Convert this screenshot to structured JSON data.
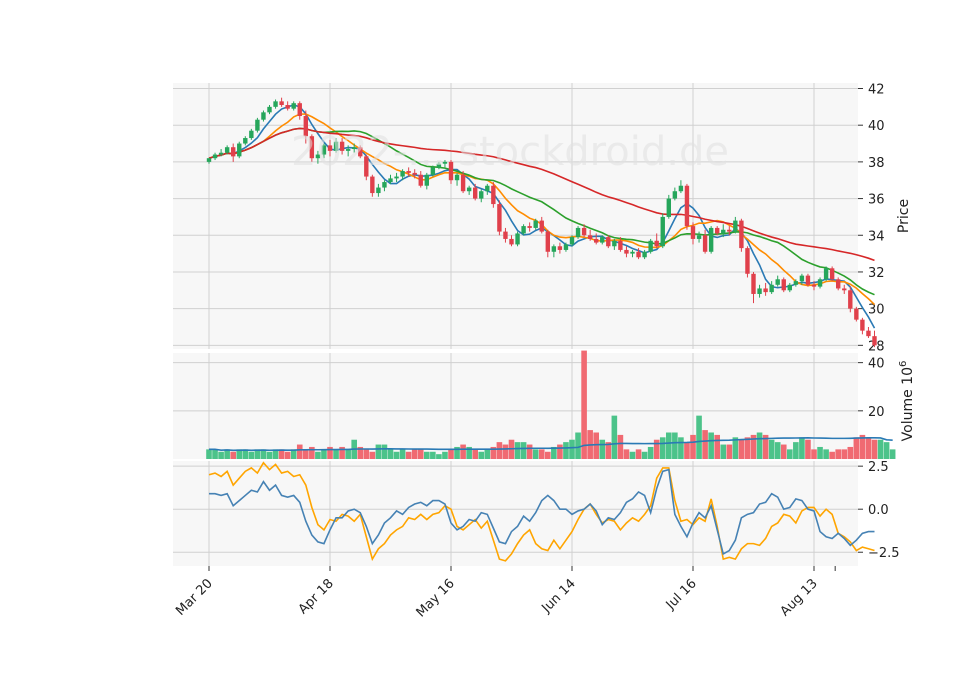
{
  "chart_data": {
    "type": "candlestick",
    "watermark": "2022-... stockdroid.de",
    "x_tick_labels": [
      "Mar 20",
      "Apr 18",
      "May 16",
      "Jun 14",
      "Jul 16",
      "Aug 13"
    ],
    "x_tick_positions": [
      0,
      20,
      40,
      60,
      80,
      100
    ],
    "panels": [
      {
        "name": "price",
        "ylabel": "Price",
        "ylim": [
          27.8,
          42.3
        ],
        "yticks": [
          28,
          30,
          32,
          34,
          36,
          38,
          40,
          42
        ],
        "up_color": "#26a65b",
        "down_color": "#e0404b",
        "ohlc": [
          [
            38.0,
            38.2,
            37.9,
            38.2
          ],
          [
            38.2,
            38.5,
            38.1,
            38.4
          ],
          [
            38.4,
            38.7,
            38.3,
            38.5
          ],
          [
            38.5,
            38.9,
            38.4,
            38.8
          ],
          [
            38.8,
            39.0,
            38.0,
            38.3
          ],
          [
            38.3,
            39.1,
            38.2,
            39.0
          ],
          [
            39.0,
            39.4,
            38.9,
            39.3
          ],
          [
            39.3,
            39.8,
            39.2,
            39.7
          ],
          [
            39.7,
            40.4,
            39.6,
            40.3
          ],
          [
            40.3,
            40.8,
            40.2,
            40.7
          ],
          [
            40.7,
            41.1,
            40.6,
            41.0
          ],
          [
            41.0,
            41.4,
            40.9,
            41.3
          ],
          [
            41.3,
            41.5,
            41.0,
            41.1
          ],
          [
            41.1,
            41.3,
            40.8,
            40.9
          ],
          [
            40.9,
            41.3,
            40.8,
            41.2
          ],
          [
            41.2,
            41.3,
            40.3,
            40.5
          ],
          [
            40.5,
            40.8,
            39.0,
            39.4
          ],
          [
            39.4,
            39.5,
            38.0,
            38.2
          ],
          [
            38.2,
            38.6,
            37.9,
            38.4
          ],
          [
            38.4,
            39.0,
            38.2,
            38.9
          ],
          [
            38.9,
            39.2,
            38.3,
            38.6
          ],
          [
            38.6,
            39.3,
            38.5,
            39.1
          ],
          [
            39.1,
            39.3,
            38.4,
            38.6
          ],
          [
            38.6,
            38.9,
            38.3,
            38.7
          ],
          [
            38.7,
            39.0,
            38.5,
            38.8
          ],
          [
            38.8,
            38.9,
            38.2,
            38.3
          ],
          [
            38.3,
            38.4,
            37.0,
            37.2
          ],
          [
            37.2,
            37.3,
            36.1,
            36.3
          ],
          [
            36.3,
            36.8,
            36.1,
            36.6
          ],
          [
            36.6,
            37.0,
            36.4,
            36.9
          ],
          [
            36.9,
            37.3,
            36.8,
            37.1
          ],
          [
            37.1,
            37.4,
            36.9,
            37.2
          ],
          [
            37.2,
            37.6,
            37.0,
            37.5
          ],
          [
            37.5,
            37.7,
            37.2,
            37.4
          ],
          [
            37.4,
            37.6,
            37.1,
            37.3
          ],
          [
            37.3,
            37.5,
            36.6,
            36.7
          ],
          [
            36.7,
            37.4,
            36.5,
            37.3
          ],
          [
            37.3,
            37.8,
            37.2,
            37.7
          ],
          [
            37.7,
            38.0,
            37.6,
            37.9
          ],
          [
            37.9,
            38.1,
            37.7,
            38.0
          ],
          [
            38.0,
            38.1,
            36.8,
            37.0
          ],
          [
            37.0,
            37.4,
            36.7,
            37.3
          ],
          [
            37.3,
            37.5,
            36.3,
            36.4
          ],
          [
            36.4,
            36.7,
            36.2,
            36.6
          ],
          [
            36.6,
            36.8,
            35.9,
            36.0
          ],
          [
            36.0,
            36.5,
            35.8,
            36.4
          ],
          [
            36.4,
            36.8,
            36.2,
            36.7
          ],
          [
            36.7,
            36.9,
            35.5,
            35.7
          ],
          [
            35.7,
            35.9,
            34.0,
            34.2
          ],
          [
            34.2,
            34.4,
            33.6,
            33.8
          ],
          [
            33.8,
            34.0,
            33.4,
            33.5
          ],
          [
            33.5,
            34.2,
            33.4,
            34.1
          ],
          [
            34.1,
            34.6,
            34.0,
            34.5
          ],
          [
            34.5,
            34.7,
            34.2,
            34.4
          ],
          [
            34.4,
            34.9,
            34.3,
            34.8
          ],
          [
            34.8,
            35.0,
            34.1,
            34.2
          ],
          [
            34.2,
            34.3,
            32.8,
            33.1
          ],
          [
            33.1,
            33.5,
            32.8,
            33.4
          ],
          [
            33.4,
            33.6,
            33.0,
            33.2
          ],
          [
            33.2,
            33.6,
            33.1,
            33.5
          ],
          [
            33.5,
            34.0,
            33.4,
            33.9
          ],
          [
            33.9,
            34.5,
            33.8,
            34.4
          ],
          [
            34.4,
            34.6,
            33.9,
            34.0
          ],
          [
            34.0,
            34.3,
            33.7,
            33.8
          ],
          [
            33.8,
            34.1,
            33.5,
            33.6
          ],
          [
            33.6,
            34.0,
            33.5,
            33.9
          ],
          [
            33.9,
            34.0,
            33.3,
            33.4
          ],
          [
            33.4,
            33.8,
            33.2,
            33.7
          ],
          [
            33.7,
            33.9,
            33.1,
            33.2
          ],
          [
            33.2,
            33.4,
            32.8,
            33.0
          ],
          [
            33.0,
            33.2,
            32.8,
            33.1
          ],
          [
            33.1,
            33.3,
            32.7,
            32.8
          ],
          [
            32.8,
            33.2,
            32.7,
            33.1
          ],
          [
            33.1,
            33.8,
            33.0,
            33.7
          ],
          [
            33.7,
            34.1,
            33.3,
            33.4
          ],
          [
            33.4,
            35.2,
            33.3,
            35.0
          ],
          [
            35.0,
            36.2,
            34.9,
            36.0
          ],
          [
            36.0,
            36.6,
            35.9,
            36.4
          ],
          [
            36.4,
            37.0,
            36.3,
            36.7
          ],
          [
            36.7,
            36.8,
            34.3,
            34.5
          ],
          [
            34.5,
            34.7,
            33.5,
            33.8
          ],
          [
            33.8,
            34.2,
            33.6,
            34.0
          ],
          [
            34.0,
            34.3,
            33.0,
            33.1
          ],
          [
            33.1,
            34.5,
            33.0,
            34.4
          ],
          [
            34.4,
            34.5,
            34.0,
            34.1
          ],
          [
            34.1,
            34.6,
            33.9,
            34.3
          ],
          [
            34.3,
            34.5,
            34.0,
            34.2
          ],
          [
            34.2,
            35.0,
            34.1,
            34.8
          ],
          [
            34.8,
            34.9,
            33.1,
            33.3
          ],
          [
            33.3,
            33.4,
            31.7,
            31.9
          ],
          [
            31.9,
            32.0,
            30.3,
            30.8
          ],
          [
            30.8,
            31.3,
            30.6,
            31.1
          ],
          [
            31.1,
            31.4,
            30.7,
            30.9
          ],
          [
            30.9,
            31.5,
            30.8,
            31.3
          ],
          [
            31.3,
            31.8,
            31.2,
            31.6
          ],
          [
            31.6,
            31.7,
            30.9,
            31.0
          ],
          [
            31.0,
            31.4,
            30.9,
            31.3
          ],
          [
            31.3,
            31.6,
            31.2,
            31.5
          ],
          [
            31.5,
            31.9,
            31.3,
            31.8
          ],
          [
            31.8,
            31.9,
            31.2,
            31.3
          ],
          [
            31.3,
            31.5,
            31.0,
            31.2
          ],
          [
            31.2,
            31.7,
            31.1,
            31.6
          ],
          [
            31.6,
            32.3,
            31.5,
            32.2
          ],
          [
            32.2,
            32.3,
            31.5,
            31.6
          ],
          [
            31.6,
            31.7,
            31.0,
            31.1
          ],
          [
            31.1,
            31.3,
            30.8,
            31.0
          ],
          [
            31.0,
            31.2,
            29.8,
            30.0
          ],
          [
            30.0,
            30.1,
            29.3,
            29.4
          ],
          [
            29.4,
            29.5,
            28.6,
            28.8
          ],
          [
            28.8,
            29.0,
            28.4,
            28.5
          ],
          [
            28.5,
            28.8,
            27.9,
            28.0
          ]
        ],
        "moving_averages": [
          {
            "window": 5,
            "color": "#2a7ab5"
          },
          {
            "window": 10,
            "color": "#ff8c00"
          },
          {
            "window": 20,
            "color": "#2ca02c"
          },
          {
            "window": 50,
            "color": "#d62728"
          }
        ]
      },
      {
        "name": "volume",
        "ylabel": "Volume 10",
        "ylabel_superscript": "6",
        "ylim": [
          0,
          44
        ],
        "yticks": [
          20,
          40
        ],
        "volume": [
          4,
          4,
          3,
          4,
          3,
          4,
          4,
          3,
          4,
          4,
          3,
          4,
          4,
          3,
          4,
          6,
          4,
          5,
          3,
          4,
          5,
          4,
          5,
          4,
          8,
          5,
          4,
          3,
          6,
          6,
          4,
          3,
          4,
          3,
          4,
          4,
          3,
          3,
          2,
          3,
          4,
          5,
          6,
          5,
          4,
          3,
          4,
          5,
          7,
          6,
          8,
          7,
          7,
          6,
          4,
          4,
          3,
          5,
          6,
          7,
          8,
          11,
          45,
          12,
          11,
          8,
          7,
          18,
          10,
          4,
          3,
          4,
          3,
          5,
          8,
          9,
          11,
          11,
          9,
          7,
          10,
          18,
          12,
          11,
          10,
          6,
          6,
          9,
          8,
          9,
          10,
          11,
          10,
          8,
          7,
          6,
          4,
          7,
          9,
          8,
          4,
          5,
          4,
          3,
          4,
          4,
          5,
          9,
          10,
          9,
          8,
          8,
          7,
          4
        ],
        "volume_ma_color": "#2a7ab5"
      },
      {
        "name": "indicator",
        "ylabel": "",
        "ylim": [
          -3.3,
          2.8
        ],
        "yticks": [
          -2.5,
          0.0,
          2.5
        ],
        "series": [
          {
            "color": "#ffa500",
            "values": [
              2.0,
              2.1,
              1.9,
              2.2,
              1.4,
              1.8,
              2.2,
              2.4,
              2.1,
              2.7,
              2.3,
              2.6,
              2.1,
              2.2,
              1.9,
              2.0,
              1.4,
              0.1,
              -0.9,
              -1.2,
              -0.6,
              -0.7,
              -0.3,
              -0.4,
              -0.7,
              -0.3,
              -1.6,
              -2.9,
              -2.3,
              -2.0,
              -1.5,
              -1.2,
              -1.0,
              -0.5,
              -0.6,
              -0.3,
              -0.6,
              -0.3,
              -0.2,
              0.2,
              0.0,
              -1.0,
              -1.2,
              -0.9,
              -0.6,
              -1.1,
              -0.7,
              -1.8,
              -2.9,
              -3.0,
              -2.6,
              -2.0,
              -1.5,
              -1.2,
              -2.0,
              -2.3,
              -2.4,
              -1.8,
              -2.3,
              -1.8,
              -1.3,
              -0.6,
              0.0,
              0.3,
              -0.3,
              -0.8,
              -0.6,
              -0.7,
              -1.2,
              -0.8,
              -0.5,
              -0.7,
              -0.3,
              0.2,
              1.8,
              2.4,
              2.4,
              0.5,
              -0.7,
              -0.6,
              -0.9,
              -0.5,
              -0.7,
              0.6,
              -1.0,
              -2.9,
              -2.8,
              -2.9,
              -2.3,
              -2.0,
              -2.0,
              -2.1,
              -1.7,
              -1.0,
              -0.8,
              -0.3,
              -0.4,
              -0.8,
              -0.1,
              0.1,
              0.1,
              -0.4,
              0.0,
              -0.3,
              -1.4,
              -1.6,
              -1.9,
              -2.4,
              -2.2,
              -2.3,
              -2.4
            ]
          },
          {
            "color": "#4682b4",
            "values": [
              0.9,
              0.9,
              0.8,
              0.9,
              0.2,
              0.5,
              0.8,
              1.1,
              1.0,
              1.6,
              1.1,
              1.4,
              0.8,
              0.7,
              0.8,
              0.4,
              -0.7,
              -1.5,
              -1.9,
              -2.0,
              -1.2,
              -0.5,
              -0.5,
              -0.1,
              0.0,
              -0.2,
              -1.0,
              -2.0,
              -1.5,
              -0.8,
              -0.5,
              -0.1,
              -0.3,
              0.1,
              0.3,
              0.4,
              0.2,
              0.5,
              0.5,
              0.3,
              -0.8,
              -1.2,
              -1.0,
              -0.6,
              -0.7,
              -0.2,
              -0.3,
              -1.1,
              -1.9,
              -2.0,
              -1.3,
              -1.0,
              -0.4,
              -0.7,
              -0.2,
              0.5,
              0.8,
              0.5,
              0.0,
              0.0,
              -0.3,
              -0.1,
              0.0,
              0.3,
              -0.1,
              -0.9,
              -0.5,
              -0.6,
              -0.2,
              0.4,
              0.6,
              1.0,
              0.8,
              -0.2,
              1.2,
              2.2,
              2.3,
              -0.3,
              -1.0,
              -1.6,
              -0.8,
              -0.2,
              -0.5,
              0.2,
              -1.2,
              -2.6,
              -2.4,
              -1.8,
              -0.5,
              -0.3,
              -0.2,
              0.3,
              0.4,
              0.9,
              0.7,
              0.0,
              0.1,
              0.6,
              0.5,
              0.0,
              -0.1,
              -1.3,
              -1.6,
              -1.7,
              -1.4,
              -1.7,
              -2.1,
              -1.8,
              -1.4,
              -1.3,
              -1.3
            ]
          }
        ]
      }
    ]
  }
}
